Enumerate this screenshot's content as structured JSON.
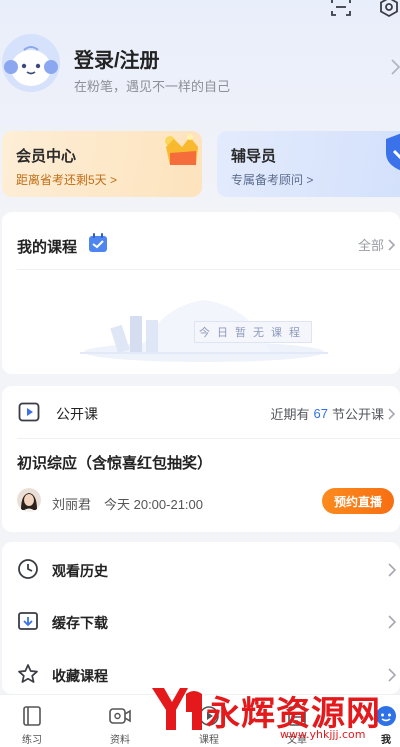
{
  "profile": {
    "title": "登录/注册",
    "subtitle": "在粉笔，遇见不一样的自己"
  },
  "cards": {
    "member": {
      "title": "会员中心",
      "subtitle": "距离省考还剩5天 >"
    },
    "tutor": {
      "title": "辅导员",
      "subtitle": "专属备考顾问 >"
    }
  },
  "courses": {
    "title": "我的课程",
    "all_label": "全部",
    "empty_text": "今日暂无课程"
  },
  "open_class": {
    "title": "公开课",
    "recent_prefix": "近期有",
    "recent_count": "67",
    "recent_suffix": "节公开课",
    "lesson_title": "初识综应（含惊喜红包抽奖）",
    "teacher": "刘丽君",
    "time": "今天 20:00-21:00",
    "reserve_label": "预约直播"
  },
  "menu": [
    {
      "label": "观看历史",
      "icon": "history-icon"
    },
    {
      "label": "缓存下载",
      "icon": "download-icon"
    },
    {
      "label": "收藏课程",
      "icon": "star-icon"
    }
  ],
  "tabs": [
    {
      "label": "练习",
      "icon": "practice-icon"
    },
    {
      "label": "资料",
      "icon": "video-icon"
    },
    {
      "label": "课程",
      "icon": "course-icon"
    },
    {
      "label": "文章",
      "icon": "article-icon"
    },
    {
      "label": "我",
      "icon": "me-icon",
      "active": true
    }
  ],
  "watermark": {
    "text": "永辉资源网",
    "url": "www.yhkjjj.com"
  },
  "colors": {
    "accent_blue": "#2f72e8",
    "reserve_orange": "#f77a18",
    "member_text": "#c16d16",
    "watermark_red": "#e4191c"
  }
}
